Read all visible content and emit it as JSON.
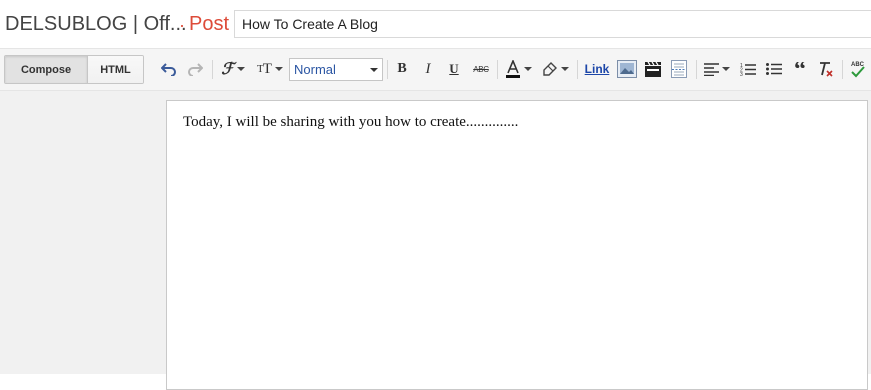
{
  "header": {
    "blog_title": "DELSUBLOG | Off...",
    "separator": "·",
    "post_label": "Post",
    "post_title_value": "How To Create A Blog"
  },
  "mode_tabs": [
    {
      "label": "Compose",
      "active": true
    },
    {
      "label": "HTML",
      "active": false
    }
  ],
  "toolbar": {
    "format_value": "Normal",
    "link_label": "Link",
    "icons": [
      "undo-icon",
      "redo-icon",
      "font-family-icon",
      "font-size-icon",
      "bold-icon",
      "italic-icon",
      "underline-icon",
      "strikethrough-icon",
      "text-color-icon",
      "highlight-color-icon",
      "insert-image-icon",
      "insert-video-icon",
      "jump-break-icon",
      "align-icon",
      "numbered-list-icon",
      "bulleted-list-icon",
      "quote-icon",
      "remove-formatting-icon",
      "spellcheck-icon"
    ]
  },
  "editor": {
    "body_text": "Today, I will be sharing with you how to create.............."
  },
  "colors": {
    "accent": "#dd4b39",
    "link": "#1c46a8",
    "toolbar_bg": "#f5f5f5",
    "workspace_bg": "#f1f1f1"
  }
}
